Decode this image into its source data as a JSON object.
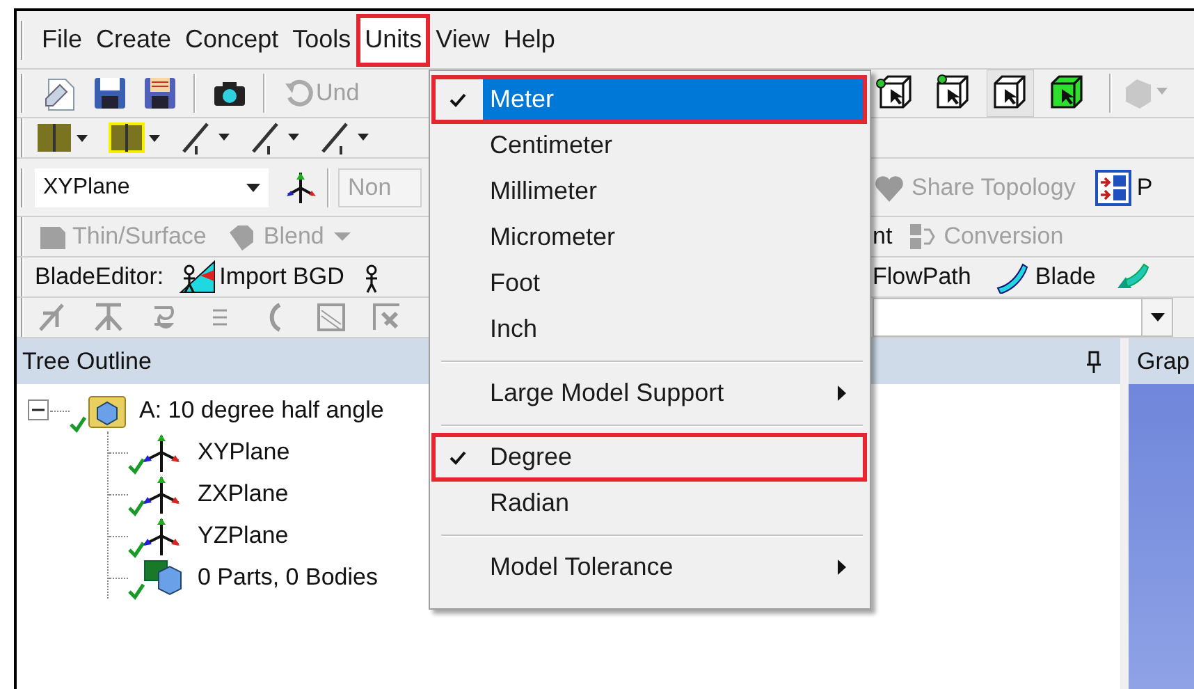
{
  "menu_bar": [
    {
      "label": "File",
      "open": false,
      "annotated": false
    },
    {
      "label": "Create",
      "open": false,
      "annotated": false
    },
    {
      "label": "Concept",
      "open": false,
      "annotated": false
    },
    {
      "label": "Tools",
      "open": false,
      "annotated": false
    },
    {
      "label": "Units",
      "open": true,
      "annotated": true
    },
    {
      "label": "View",
      "open": false,
      "annotated": false
    },
    {
      "label": "Help",
      "open": false,
      "annotated": false
    }
  ],
  "standard_toolbar": {
    "undo": {
      "label": "Und",
      "disabled": true
    }
  },
  "plane_toolbar": {
    "plane": {
      "value": "XYPlane"
    },
    "sketch": {
      "value": "Non",
      "disabled": true
    },
    "share_topology": {
      "label": "Share Topology",
      "disabled": true
    },
    "button_4": {
      "label": "P",
      "disabled": false
    }
  },
  "features_toolbar": {
    "buttons": [
      {
        "label": "Thin/Surface",
        "disabled": true
      },
      {
        "label": "Blend",
        "disabled": true
      },
      {
        "label": "nt",
        "disabled": false
      },
      {
        "label": "Conversion",
        "disabled": true
      }
    ]
  },
  "blade_toolbar": {
    "title": "BladeEditor:",
    "buttons": [
      {
        "label": "Import BGD"
      },
      {
        "label": "FlowPath"
      },
      {
        "label": "Blade"
      }
    ]
  },
  "tree_outline": {
    "title": "Tree Outline",
    "items": [
      {
        "label": "A: 10 degree half angle",
        "expanded": true,
        "children": [
          {
            "label": "XYPlane",
            "kind": "plane"
          },
          {
            "label": "ZXPlane",
            "kind": "plane"
          },
          {
            "label": "YZPlane",
            "kind": "plane"
          },
          {
            "label": "0 Parts, 0 Bodies",
            "kind": "bodies"
          }
        ]
      }
    ]
  },
  "graphics": {
    "title": "Grap"
  },
  "units_menu": {
    "items": [
      {
        "kind": "item",
        "label": "Meter",
        "checked": true,
        "selected": true,
        "annotated": true
      },
      {
        "kind": "item",
        "label": "Centimeter",
        "checked": false,
        "selected": false,
        "annotated": false
      },
      {
        "kind": "item",
        "label": "Millimeter",
        "checked": false,
        "selected": false,
        "annotated": false
      },
      {
        "kind": "item",
        "label": "Micrometer",
        "checked": false,
        "selected": false,
        "annotated": false
      },
      {
        "kind": "item",
        "label": "Foot",
        "checked": false,
        "selected": false,
        "annotated": false
      },
      {
        "kind": "item",
        "label": "Inch",
        "checked": false,
        "selected": false,
        "annotated": false
      },
      {
        "kind": "separator"
      },
      {
        "kind": "submenu",
        "label": "Large Model Support",
        "selected": false,
        "annotated": false
      },
      {
        "kind": "separator"
      },
      {
        "kind": "item",
        "label": "Degree",
        "checked": true,
        "selected": false,
        "annotated": true
      },
      {
        "kind": "item",
        "label": "Radian",
        "checked": false,
        "selected": false,
        "annotated": false
      },
      {
        "kind": "separator"
      },
      {
        "kind": "submenu",
        "label": "Model Tolerance",
        "selected": false,
        "annotated": false
      }
    ]
  }
}
